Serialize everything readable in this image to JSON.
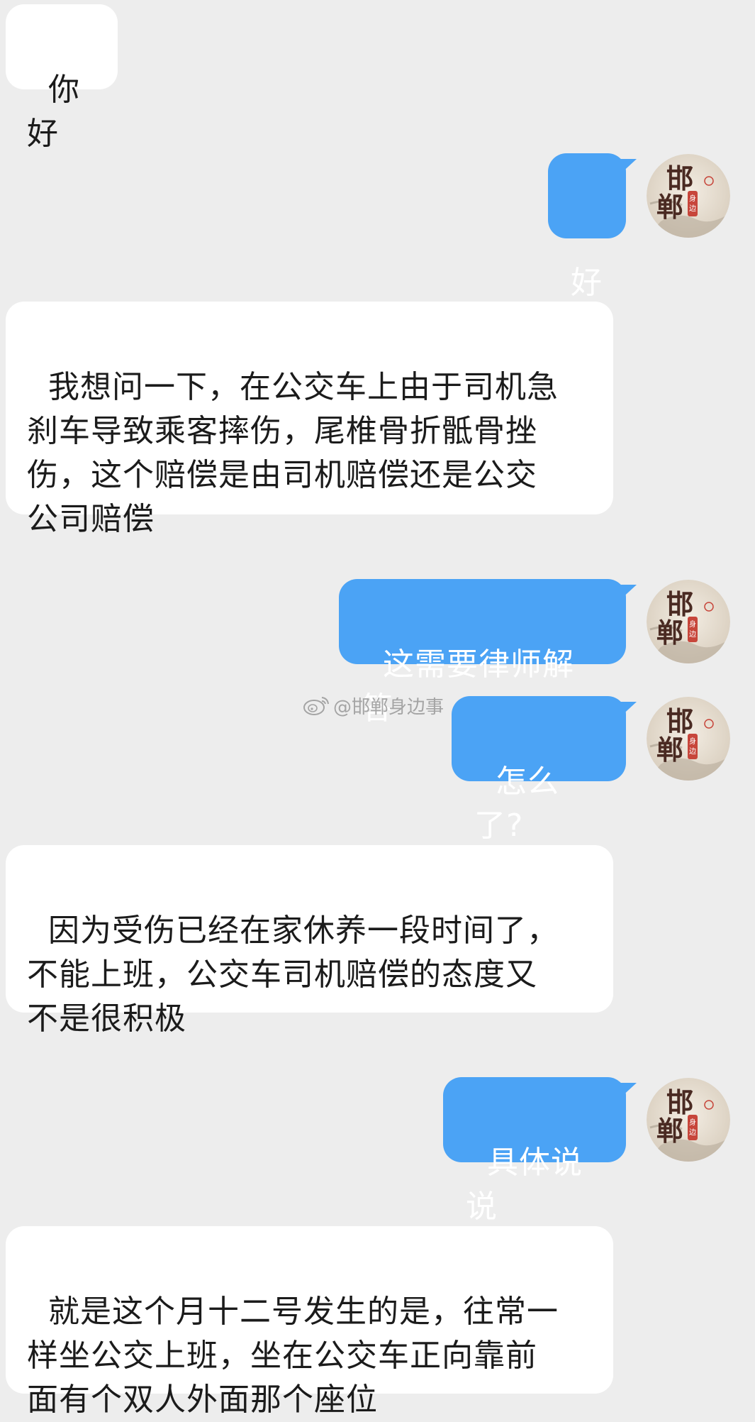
{
  "messages": [
    {
      "side": "in",
      "text": "你好"
    },
    {
      "side": "out",
      "text": "好"
    },
    {
      "side": "in",
      "text": "我想问一下，在公交车上由于司机急\n刹车导致乘客摔伤，尾椎骨折骶骨挫\n伤，这个赔偿是由司机赔偿还是公交\n公司赔偿"
    },
    {
      "side": "out",
      "text": "这需要律师解答"
    },
    {
      "side": "out",
      "text": "怎么了?"
    },
    {
      "side": "in",
      "text": "因为受伤已经在家休养一段时间了，\n不能上班，公交车司机赔偿的态度又\n不是很积极"
    },
    {
      "side": "out",
      "text": "具体说说"
    },
    {
      "side": "in",
      "text": "就是这个月十二号发生的是，往常一\n样坐公交上班，坐在公交车正向靠前\n面有个双人外面那个座位"
    }
  ],
  "avatar": {
    "logo_text": "邯郸身边事"
  },
  "watermark": {
    "text": "@邯郸身边事",
    "icon": "weibo-icon"
  },
  "colors": {
    "background": "#ededed",
    "incoming_bubble": "#ffffff",
    "outgoing_bubble": "#4ba3f5"
  }
}
